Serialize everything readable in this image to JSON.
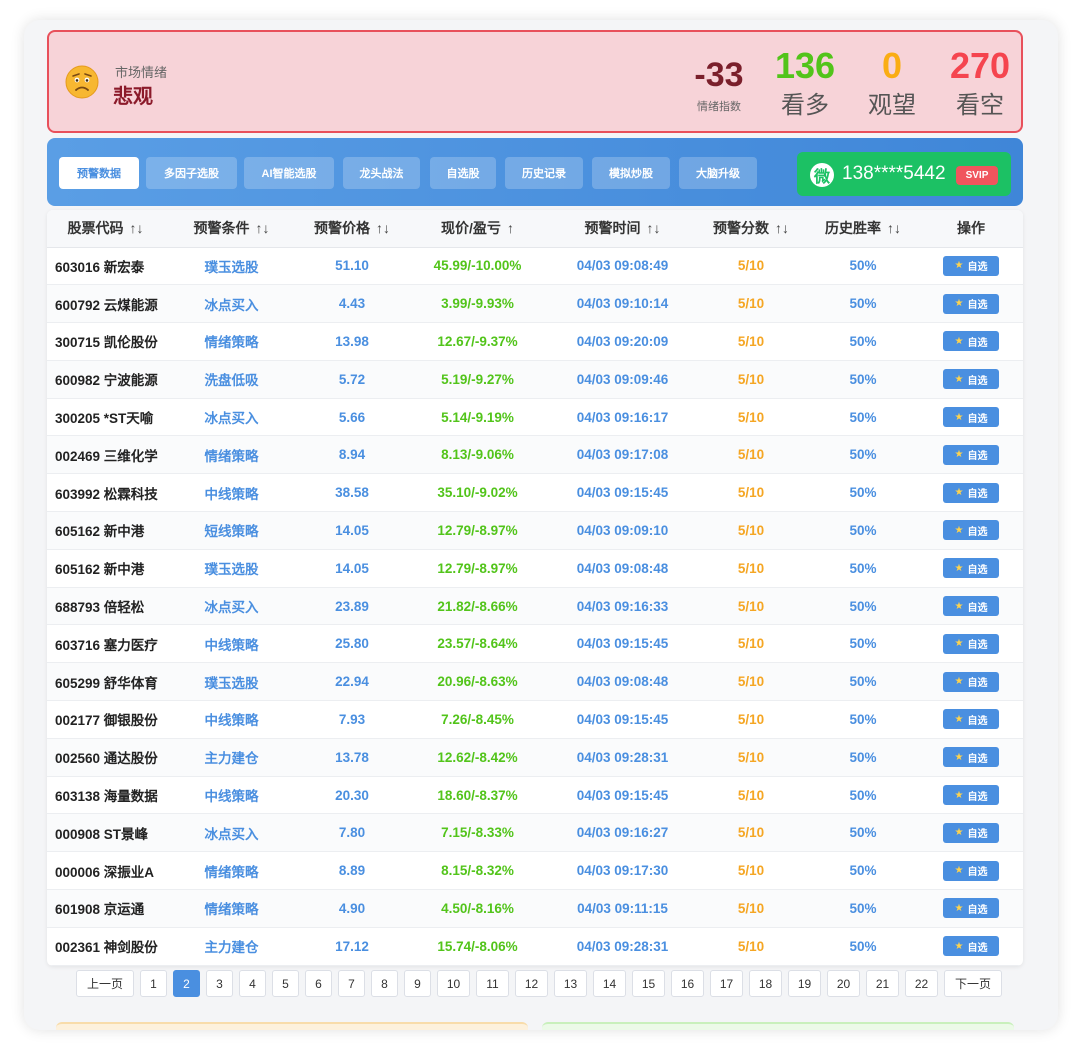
{
  "sentiment": {
    "label": "市场情绪",
    "value": "悲观",
    "face_icon": "worried-face-icon",
    "index_value": "-33",
    "index_label": "情绪指数",
    "bullish_count": "136",
    "bullish_label": "看多",
    "neutral_count": "0",
    "neutral_label": "观望",
    "bearish_count": "270",
    "bearish_label": "看空",
    "colors": {
      "bullish": "#52c41a",
      "neutral": "#faad14",
      "bearish": "#f5454f",
      "index": "#7a1f2b"
    }
  },
  "tabs": [
    {
      "label": "预警数据",
      "active": true
    },
    {
      "label": "多因子选股"
    },
    {
      "label": "AI智能选股"
    },
    {
      "label": "龙头战法"
    },
    {
      "label": "自选股"
    },
    {
      "label": "历史记录"
    },
    {
      "label": "模拟炒股"
    },
    {
      "label": "大脑升级"
    }
  ],
  "user": {
    "wechat_glyph": "微",
    "phone": "138****5442",
    "badge": "SVIP"
  },
  "table": {
    "headers": [
      {
        "label": "股票代码",
        "sort": "↑↓"
      },
      {
        "label": "预警条件",
        "sort": "↑↓"
      },
      {
        "label": "预警价格",
        "sort": "↑↓"
      },
      {
        "label": "现价/盈亏",
        "sort": "↑"
      },
      {
        "label": "预警时间",
        "sort": "↑↓"
      },
      {
        "label": "预警分数",
        "sort": "↑↓"
      },
      {
        "label": "历史胜率",
        "sort": "↑↓"
      },
      {
        "label": "操作",
        "sort": ""
      }
    ],
    "action_label": "自选",
    "rows": [
      {
        "stock": "603016 新宏泰",
        "cond": "璞玉选股",
        "price": "51.10",
        "cur": "45.99/-10.00%",
        "time": "04/03 09:08:49",
        "score": "5/10",
        "rate": "50%"
      },
      {
        "stock": "600792 云煤能源",
        "cond": "冰点买入",
        "price": "4.43",
        "cur": "3.99/-9.93%",
        "time": "04/03 09:10:14",
        "score": "5/10",
        "rate": "50%"
      },
      {
        "stock": "300715 凯伦股份",
        "cond": "情绪策略",
        "price": "13.98",
        "cur": "12.67/-9.37%",
        "time": "04/03 09:20:09",
        "score": "5/10",
        "rate": "50%"
      },
      {
        "stock": "600982 宁波能源",
        "cond": "洗盘低吸",
        "price": "5.72",
        "cur": "5.19/-9.27%",
        "time": "04/03 09:09:46",
        "score": "5/10",
        "rate": "50%"
      },
      {
        "stock": "300205 *ST天喻",
        "cond": "冰点买入",
        "price": "5.66",
        "cur": "5.14/-9.19%",
        "time": "04/03 09:16:17",
        "score": "5/10",
        "rate": "50%"
      },
      {
        "stock": "002469 三维化学",
        "cond": "情绪策略",
        "price": "8.94",
        "cur": "8.13/-9.06%",
        "time": "04/03 09:17:08",
        "score": "5/10",
        "rate": "50%"
      },
      {
        "stock": "603992 松霖科技",
        "cond": "中线策略",
        "price": "38.58",
        "cur": "35.10/-9.02%",
        "time": "04/03 09:15:45",
        "score": "5/10",
        "rate": "50%"
      },
      {
        "stock": "605162 新中港",
        "cond": "短线策略",
        "price": "14.05",
        "cur": "12.79/-8.97%",
        "time": "04/03 09:09:10",
        "score": "5/10",
        "rate": "50%"
      },
      {
        "stock": "605162 新中港",
        "cond": "璞玉选股",
        "price": "14.05",
        "cur": "12.79/-8.97%",
        "time": "04/03 09:08:48",
        "score": "5/10",
        "rate": "50%"
      },
      {
        "stock": "688793 倍轻松",
        "cond": "冰点买入",
        "price": "23.89",
        "cur": "21.82/-8.66%",
        "time": "04/03 09:16:33",
        "score": "5/10",
        "rate": "50%"
      },
      {
        "stock": "603716 塞力医疗",
        "cond": "中线策略",
        "price": "25.80",
        "cur": "23.57/-8.64%",
        "time": "04/03 09:15:45",
        "score": "5/10",
        "rate": "50%"
      },
      {
        "stock": "605299 舒华体育",
        "cond": "璞玉选股",
        "price": "22.94",
        "cur": "20.96/-8.63%",
        "time": "04/03 09:08:48",
        "score": "5/10",
        "rate": "50%"
      },
      {
        "stock": "002177 御银股份",
        "cond": "中线策略",
        "price": "7.93",
        "cur": "7.26/-8.45%",
        "time": "04/03 09:15:45",
        "score": "5/10",
        "rate": "50%"
      },
      {
        "stock": "002560 通达股份",
        "cond": "主力建仓",
        "price": "13.78",
        "cur": "12.62/-8.42%",
        "time": "04/03 09:28:31",
        "score": "5/10",
        "rate": "50%"
      },
      {
        "stock": "603138 海量数据",
        "cond": "中线策略",
        "price": "20.30",
        "cur": "18.60/-8.37%",
        "time": "04/03 09:15:45",
        "score": "5/10",
        "rate": "50%"
      },
      {
        "stock": "000908 ST景峰",
        "cond": "冰点买入",
        "price": "7.80",
        "cur": "7.15/-8.33%",
        "time": "04/03 09:16:27",
        "score": "5/10",
        "rate": "50%"
      },
      {
        "stock": "000006 深振业A",
        "cond": "情绪策略",
        "price": "8.89",
        "cur": "8.15/-8.32%",
        "time": "04/03 09:17:30",
        "score": "5/10",
        "rate": "50%"
      },
      {
        "stock": "601908 京运通",
        "cond": "情绪策略",
        "price": "4.90",
        "cur": "4.50/-8.16%",
        "time": "04/03 09:11:15",
        "score": "5/10",
        "rate": "50%"
      },
      {
        "stock": "002361 神剑股份",
        "cond": "主力建仓",
        "price": "17.12",
        "cur": "15.74/-8.06%",
        "time": "04/03 09:28:31",
        "score": "5/10",
        "rate": "50%"
      }
    ]
  },
  "pagination": {
    "prev": "上一页",
    "next": "下一页",
    "current": "2",
    "pages": [
      "1",
      "2",
      "3",
      "4",
      "5",
      "6",
      "7",
      "8",
      "9",
      "10",
      "11",
      "12",
      "13",
      "14",
      "15",
      "16",
      "17",
      "18",
      "19",
      "20",
      "21",
      "22"
    ]
  }
}
